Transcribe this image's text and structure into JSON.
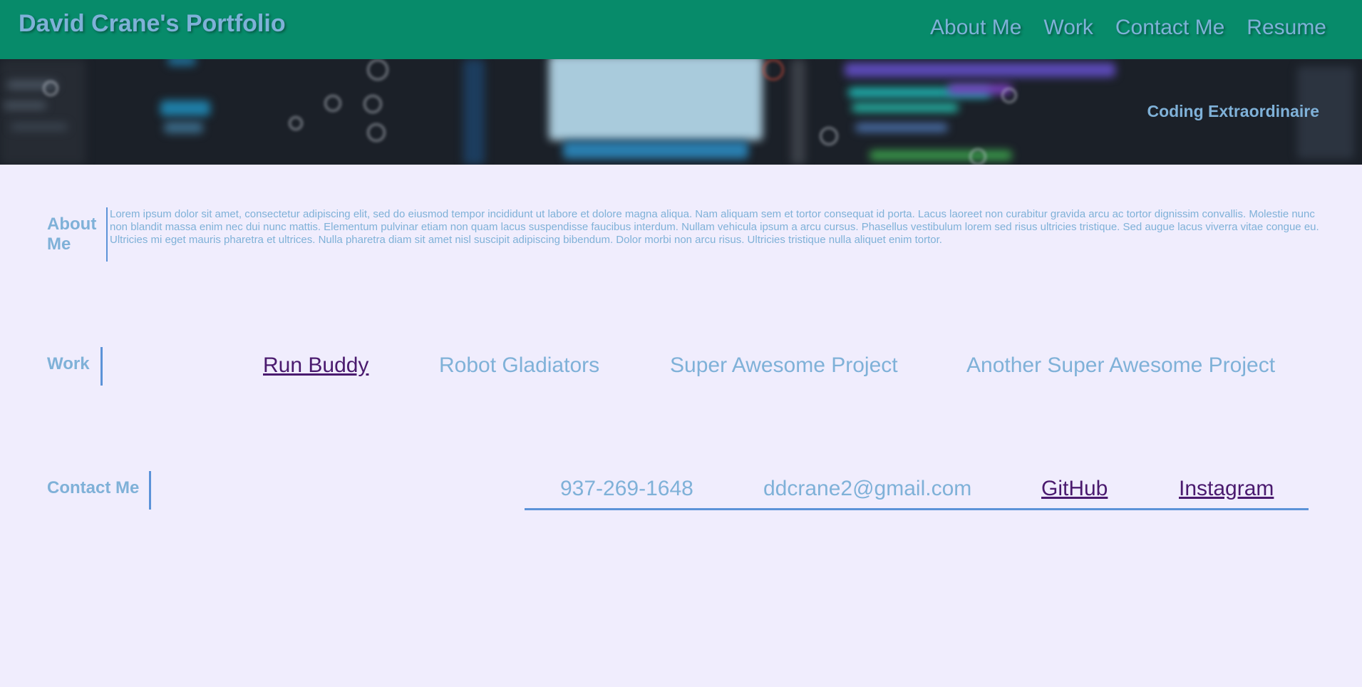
{
  "header": {
    "title": "David Crane's Portfolio",
    "nav": [
      "About Me",
      "Work",
      "Contact Me",
      "Resume"
    ]
  },
  "hero": {
    "tagline": "Coding Extraordinaire"
  },
  "about": {
    "title": "About Me",
    "text": "Lorem ipsum dolor sit amet, consectetur adipiscing elit, sed do eiusmod tempor incididunt ut labore et dolore magna aliqua. Nam aliquam sem et tortor consequat id porta. Lacus laoreet non curabitur gravida arcu ac tortor dignissim convallis. Molestie nunc non blandit massa enim nec dui nunc mattis. Elementum pulvinar etiam non quam lacus suspendisse faucibus interdum. Nullam vehicula ipsum a arcu cursus. Phasellus vestibulum lorem sed risus ultricies tristique. Sed augue lacus viverra vitae congue eu. Ultricies mi eget mauris pharetra et ultrices. Nulla pharetra diam sit amet nisl suscipit adipiscing bibendum. Dolor morbi non arcu risus. Ultricies tristique nulla aliquet enim tortor."
  },
  "work": {
    "title": "Work",
    "projects": [
      "Run Buddy",
      "Robot Gladiators",
      "Super Awesome Project",
      "Another Super Awesome Project"
    ]
  },
  "contact": {
    "title": "Contact Me",
    "phone": "937-269-1648",
    "email": "ddcrane2@gmail.com",
    "github": "GitHub",
    "instagram": "Instagram"
  },
  "colors": {
    "header_bg": "#078b6a",
    "page_bg": "#f0edfd",
    "accent_text": "#7fb1d8",
    "rule": "#5c93d8",
    "visited_link": "#4a1a6e"
  }
}
